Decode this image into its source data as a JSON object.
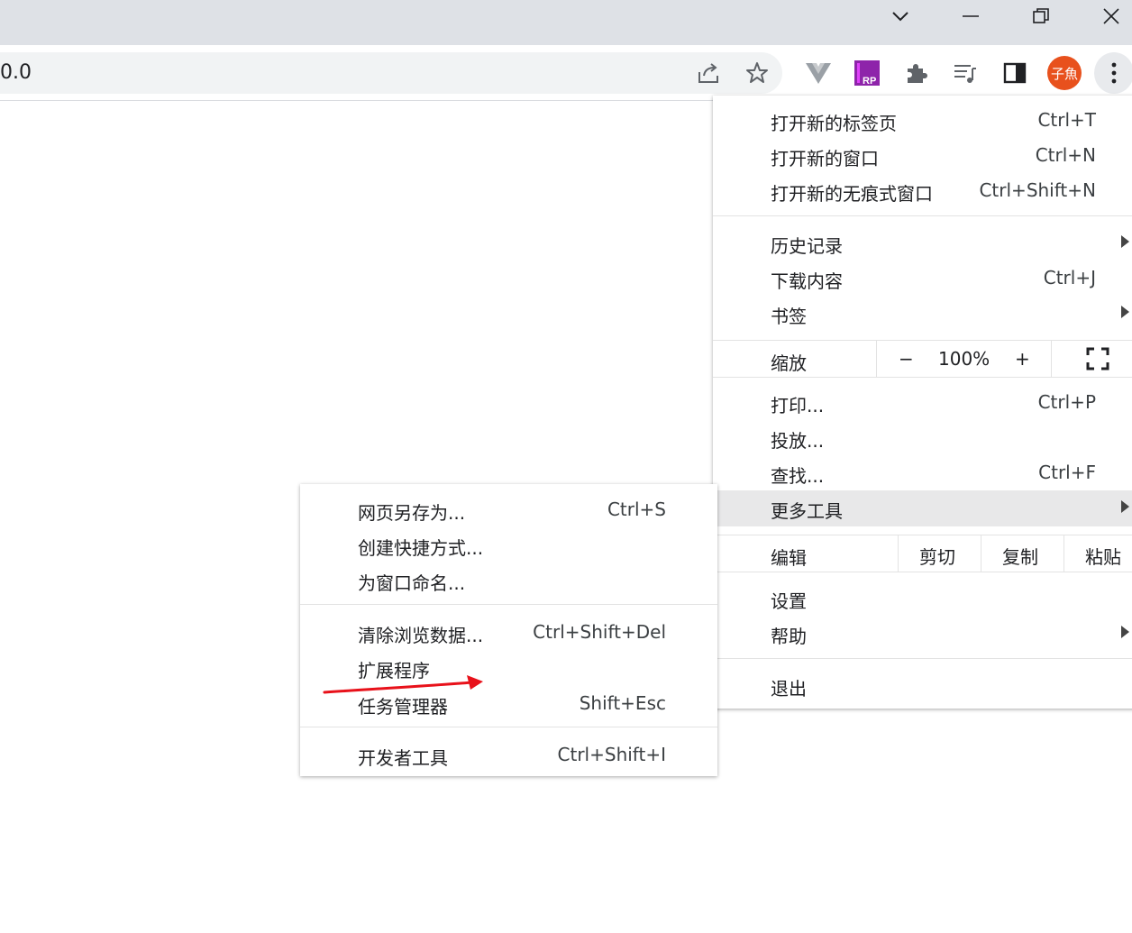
{
  "omnibox": {
    "text": "0.0"
  },
  "icons": {
    "minimize": "chevron-down-icon",
    "share": "share-icon",
    "bookmark": "star-icon",
    "extensions": "puzzle-icon",
    "reading_list": "reading-list-icon",
    "side_panel": "side-panel-icon",
    "menu": "kebab-menu-icon",
    "fullscreen": "fullscreen-icon"
  },
  "profile": {
    "avatar_text": "子魚"
  },
  "main_menu": {
    "new_tab": {
      "label": "打开新的标签页",
      "shortcut": "Ctrl+T"
    },
    "new_window": {
      "label": "打开新的窗口",
      "shortcut": "Ctrl+N"
    },
    "incognito": {
      "label": "打开新的无痕式窗口",
      "shortcut": "Ctrl+Shift+N"
    },
    "history": {
      "label": "历史记录"
    },
    "downloads": {
      "label": "下载内容",
      "shortcut": "Ctrl+J"
    },
    "bookmarks": {
      "label": "书签"
    },
    "zoom": {
      "label": "缩放",
      "minus": "−",
      "value": "100%",
      "plus": "+"
    },
    "print": {
      "label": "打印...",
      "shortcut": "Ctrl+P"
    },
    "cast": {
      "label": "投放..."
    },
    "find": {
      "label": "查找...",
      "shortcut": "Ctrl+F"
    },
    "more_tools": {
      "label": "更多工具"
    },
    "edit": {
      "label": "编辑",
      "cut": "剪切",
      "copy": "复制",
      "paste": "粘贴"
    },
    "settings": {
      "label": "设置"
    },
    "help": {
      "label": "帮助"
    },
    "exit": {
      "label": "退出"
    }
  },
  "sub_menu": {
    "save_page": {
      "label": "网页另存为...",
      "shortcut": "Ctrl+S"
    },
    "create_shortcut": {
      "label": "创建快捷方式..."
    },
    "name_window": {
      "label": "为窗口命名..."
    },
    "clear_data": {
      "label": "清除浏览数据...",
      "shortcut": "Ctrl+Shift+Del"
    },
    "extensions": {
      "label": "扩展程序"
    },
    "task_manager": {
      "label": "任务管理器",
      "shortcut": "Shift+Esc"
    },
    "dev_tools": {
      "label": "开发者工具",
      "shortcut": "Ctrl+Shift+I"
    }
  },
  "colors": {
    "accent_arrow": "#e8111a",
    "avatar_bg": "#e8511d",
    "highlight": "#e8e8e9"
  }
}
